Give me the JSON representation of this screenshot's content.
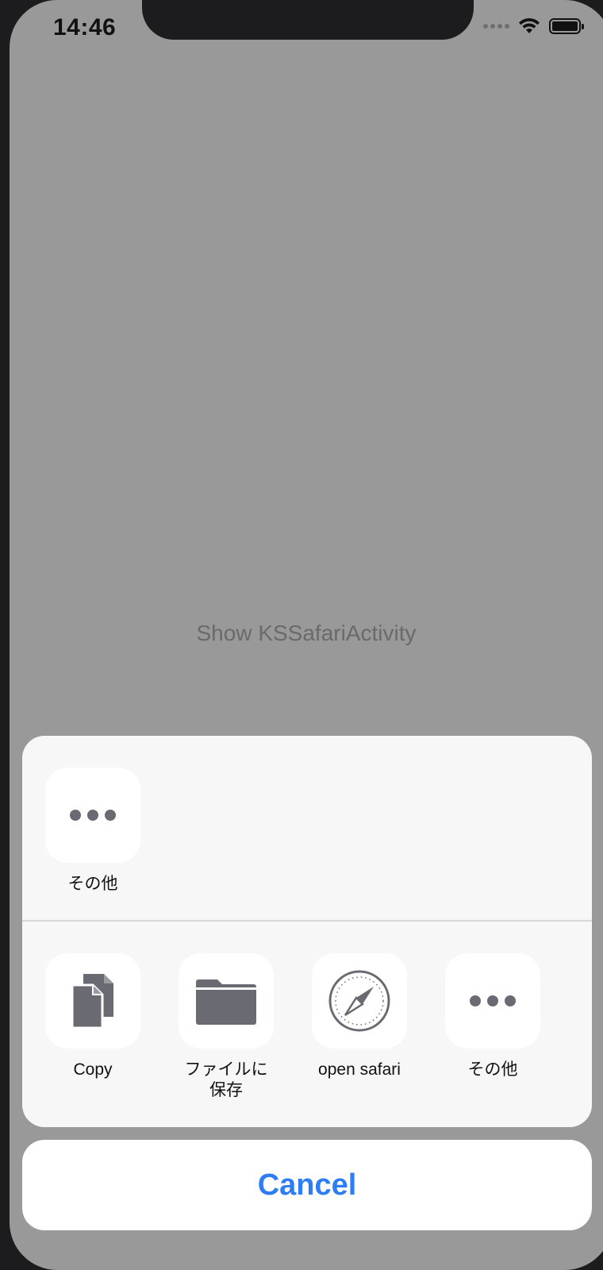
{
  "status_bar": {
    "time": "14:46"
  },
  "main": {
    "link_text": "Show KSSafariActivity"
  },
  "share_sheet": {
    "top_row": [
      {
        "label": "その他",
        "icon": "more-icon"
      }
    ],
    "bottom_row": [
      {
        "label": "Copy",
        "icon": "copy-icon"
      },
      {
        "label": "ファイルに\n保存",
        "icon": "folder-icon"
      },
      {
        "label": "open safari",
        "icon": "safari-compass-icon"
      },
      {
        "label": "その他",
        "icon": "more-icon"
      }
    ],
    "cancel_label": "Cancel"
  },
  "colors": {
    "accent": "#2f7df6",
    "icon_gray": "#6a6a72",
    "dim_background": "#999999"
  }
}
